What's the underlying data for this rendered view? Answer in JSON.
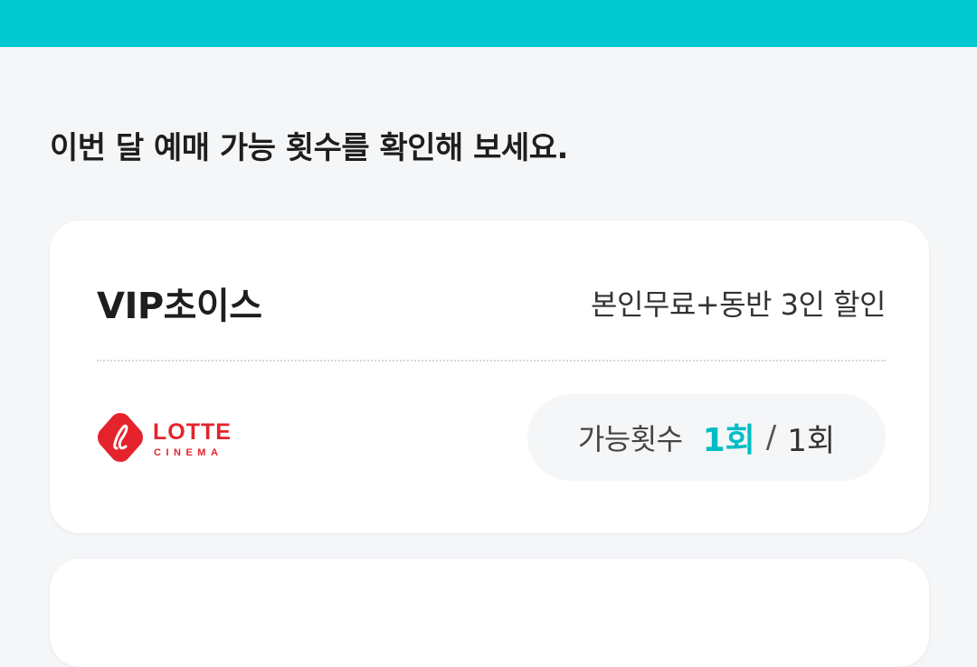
{
  "header": {
    "bar_color": "#00c8d0"
  },
  "main": {
    "heading": "이번 달 예매 가능 횟수를 확인해 보세요."
  },
  "card": {
    "title": "VIP초이스",
    "benefit": "본인무료+동반 3인 할인",
    "brand": {
      "logo_icon": "lotte-cinema-logo",
      "logo_text_top": "LOTTE",
      "logo_text_bottom": "CINEMA",
      "color": "#e5232c"
    },
    "count": {
      "label": "가능횟수",
      "used": "1회",
      "separator": "/",
      "total": "1회",
      "accent_color": "#00bcc4"
    }
  }
}
